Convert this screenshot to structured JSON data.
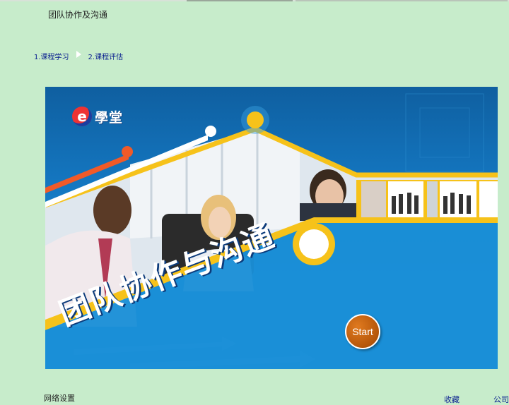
{
  "page": {
    "title": "团队协作及沟通"
  },
  "steps": [
    {
      "label": "1.课程学习"
    },
    {
      "label": "2.课程评估"
    }
  ],
  "banner": {
    "brand_letter": "e",
    "brand_name": "學堂",
    "course_title": "团队协作与沟通",
    "start_label": "Start",
    "colors": {
      "yellow_band": "#f6c21a",
      "orange_stripe": "#f05a28",
      "start_button": "#c4620f",
      "banner_blue": "#1a8fd6"
    }
  },
  "footer": {
    "left_text": "网络设置",
    "link1": "收藏",
    "link2": "公司"
  }
}
